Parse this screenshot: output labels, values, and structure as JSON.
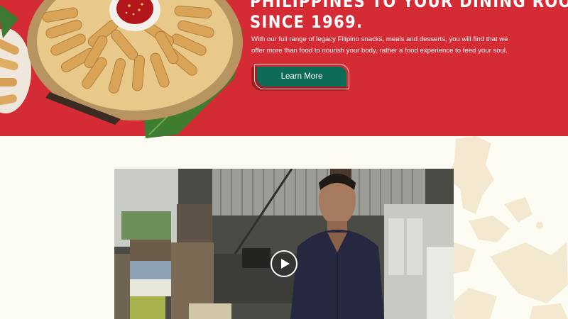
{
  "hero": {
    "headline_line1": "PHILIPPINES TO YOUR DINING ROOM TABLE",
    "headline_line2": "SINCE 1969.",
    "body": "With our full range of legacy Filipino snacks, meals and desserts, you will find that we offer more than food to nourish your body, rather a food experience to feed your soul.",
    "cta_label": "Learn More",
    "background_color": "#d42b34",
    "cta_color": "#0e6b58"
  },
  "video": {
    "play_icon": "play-icon"
  },
  "page": {
    "background_color": "#fdfcf2"
  }
}
